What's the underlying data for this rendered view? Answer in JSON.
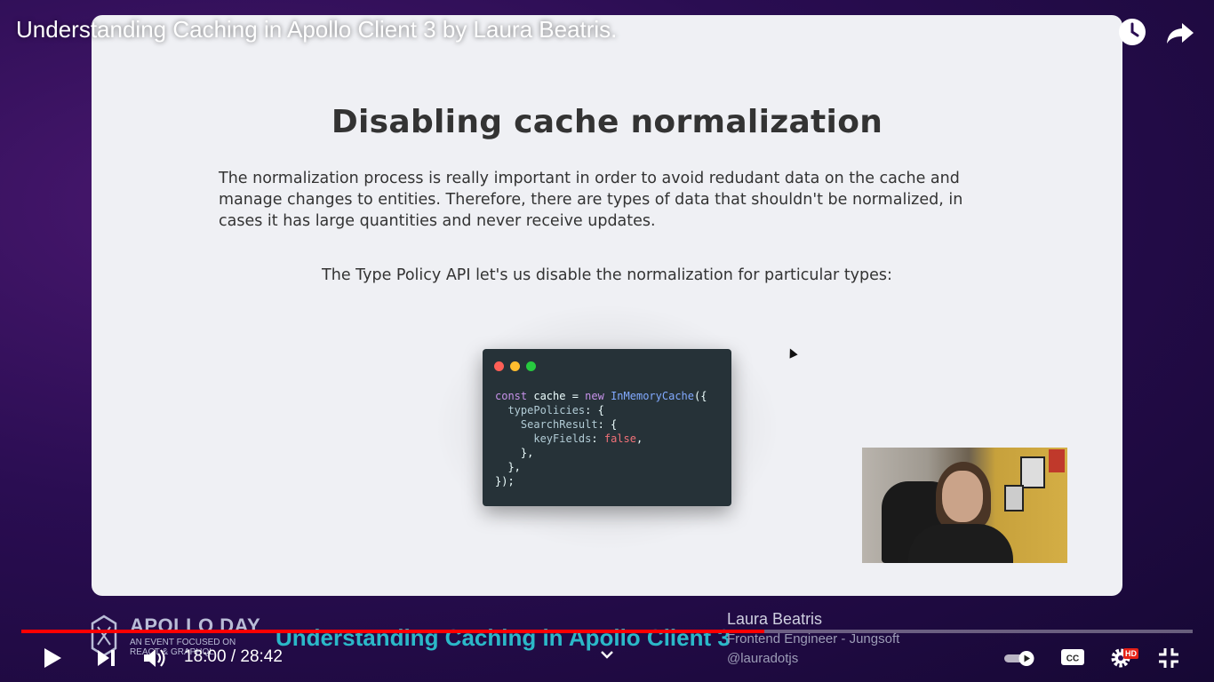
{
  "video": {
    "title": "Understanding Caching in Apollo Client 3 by Laura Beatris."
  },
  "slide": {
    "title": "Disabling cache normalization",
    "paragraph": "The normalization process is really important in order to avoid redudant data on the cache and manage changes to entities. Therefore, there are types of data that shouldn't be normalized, in cases it has large quantities and never receive updates.",
    "subtitle": "The Type Policy API let's us disable the normalization for particular types:",
    "code_lines": [
      "const cache = new InMemoryCache({",
      "  typePolicies: {",
      "    SearchResult: {",
      "      keyFields: false,",
      "    },",
      "  },",
      "});"
    ]
  },
  "banner": {
    "brand": "APOLLO DAY",
    "tagline": "AN EVENT FOCUSED ON REACT & GRAPHQL",
    "talk_title": "Understanding Caching in Apollo Client 3",
    "speaker_name": "Laura Beatris",
    "speaker_role": "Frontend Engineer - Jungsoft",
    "speaker_handle": "@lauradotjs"
  },
  "player": {
    "time_display": "18:00 / 28:42",
    "progress_fraction": 0.634,
    "hd_badge": "HD",
    "accent_color": "#ff0000",
    "icons": [
      "watch-later-icon",
      "share-icon",
      "play-icon",
      "next-icon",
      "volume-icon",
      "chevron-down-icon",
      "autoplay-toggle-icon",
      "captions-icon",
      "settings-icon",
      "exit-fullscreen-icon"
    ]
  }
}
